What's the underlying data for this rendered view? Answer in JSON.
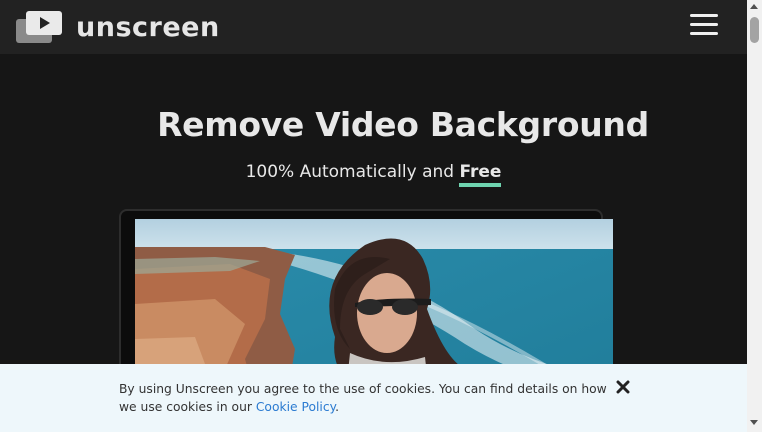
{
  "brand": {
    "name": "unscreen"
  },
  "hero": {
    "title": "Remove Video Background",
    "subtitle_prefix": "100% Automatically and ",
    "subtitle_highlight": "Free"
  },
  "cookie_banner": {
    "text_before_link": "By using Unscreen you agree to the use of cookies. You can find details on how we use cookies in our ",
    "link_text": "Cookie Policy",
    "text_after_link": "."
  },
  "icons": {
    "logo": "play-stack-icon",
    "menu": "hamburger-menu-icon",
    "close": "close-icon"
  },
  "colors": {
    "navbar": "#222222",
    "page_background": "#161616",
    "highlight_underline": "#6fd4b0",
    "cookie_banner": "#eef7fb",
    "link": "#2b7bd1"
  }
}
